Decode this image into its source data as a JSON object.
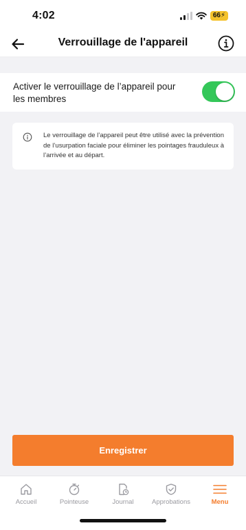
{
  "status_bar": {
    "time": "4:02",
    "battery": "66"
  },
  "header": {
    "title": "Verrouillage de l'appareil",
    "back_icon": "arrow-left-icon",
    "info_icon": "info-circle-icon"
  },
  "settings": {
    "device_lock_label": "Activer le verrouillage de l’appareil pour les membres",
    "device_lock_enabled": true
  },
  "info_card": {
    "text": "Le verrouillage de l’appareil peut être utilisé avec la prévention de l’usurpation faciale pour éliminer les pointages frauduleux à l’arrivée et au départ."
  },
  "actions": {
    "save_label": "Enregistrer"
  },
  "tab_bar": {
    "items": [
      {
        "label": "Accueil",
        "icon": "home-icon",
        "active": false
      },
      {
        "label": "Pointeuse",
        "icon": "stopwatch-icon",
        "active": false
      },
      {
        "label": "Journal",
        "icon": "timesheet-icon",
        "active": false
      },
      {
        "label": "Approbations",
        "icon": "shield-check-icon",
        "active": false
      },
      {
        "label": "Menu",
        "icon": "menu-icon",
        "active": true
      }
    ]
  },
  "colors": {
    "accent": "#f47d2d",
    "toggle_on": "#34c759",
    "battery": "#f4c22b"
  }
}
